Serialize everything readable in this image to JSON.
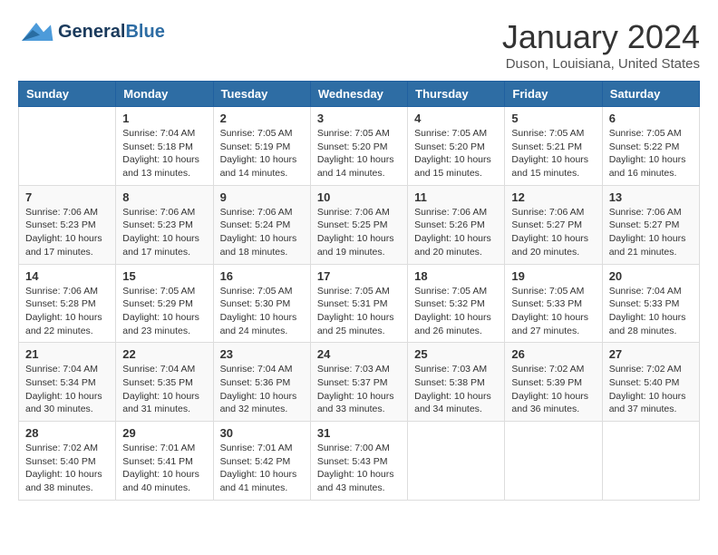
{
  "header": {
    "logo_general": "General",
    "logo_blue": "Blue",
    "month_title": "January 2024",
    "location": "Duson, Louisiana, United States"
  },
  "days_of_week": [
    "Sunday",
    "Monday",
    "Tuesday",
    "Wednesday",
    "Thursday",
    "Friday",
    "Saturday"
  ],
  "weeks": [
    [
      {
        "day": "",
        "info": ""
      },
      {
        "day": "1",
        "info": "Sunrise: 7:04 AM\nSunset: 5:18 PM\nDaylight: 10 hours\nand 13 minutes."
      },
      {
        "day": "2",
        "info": "Sunrise: 7:05 AM\nSunset: 5:19 PM\nDaylight: 10 hours\nand 14 minutes."
      },
      {
        "day": "3",
        "info": "Sunrise: 7:05 AM\nSunset: 5:20 PM\nDaylight: 10 hours\nand 14 minutes."
      },
      {
        "day": "4",
        "info": "Sunrise: 7:05 AM\nSunset: 5:20 PM\nDaylight: 10 hours\nand 15 minutes."
      },
      {
        "day": "5",
        "info": "Sunrise: 7:05 AM\nSunset: 5:21 PM\nDaylight: 10 hours\nand 15 minutes."
      },
      {
        "day": "6",
        "info": "Sunrise: 7:05 AM\nSunset: 5:22 PM\nDaylight: 10 hours\nand 16 minutes."
      }
    ],
    [
      {
        "day": "7",
        "info": "Sunrise: 7:06 AM\nSunset: 5:23 PM\nDaylight: 10 hours\nand 17 minutes."
      },
      {
        "day": "8",
        "info": "Sunrise: 7:06 AM\nSunset: 5:23 PM\nDaylight: 10 hours\nand 17 minutes."
      },
      {
        "day": "9",
        "info": "Sunrise: 7:06 AM\nSunset: 5:24 PM\nDaylight: 10 hours\nand 18 minutes."
      },
      {
        "day": "10",
        "info": "Sunrise: 7:06 AM\nSunset: 5:25 PM\nDaylight: 10 hours\nand 19 minutes."
      },
      {
        "day": "11",
        "info": "Sunrise: 7:06 AM\nSunset: 5:26 PM\nDaylight: 10 hours\nand 20 minutes."
      },
      {
        "day": "12",
        "info": "Sunrise: 7:06 AM\nSunset: 5:27 PM\nDaylight: 10 hours\nand 20 minutes."
      },
      {
        "day": "13",
        "info": "Sunrise: 7:06 AM\nSunset: 5:27 PM\nDaylight: 10 hours\nand 21 minutes."
      }
    ],
    [
      {
        "day": "14",
        "info": "Sunrise: 7:06 AM\nSunset: 5:28 PM\nDaylight: 10 hours\nand 22 minutes."
      },
      {
        "day": "15",
        "info": "Sunrise: 7:05 AM\nSunset: 5:29 PM\nDaylight: 10 hours\nand 23 minutes."
      },
      {
        "day": "16",
        "info": "Sunrise: 7:05 AM\nSunset: 5:30 PM\nDaylight: 10 hours\nand 24 minutes."
      },
      {
        "day": "17",
        "info": "Sunrise: 7:05 AM\nSunset: 5:31 PM\nDaylight: 10 hours\nand 25 minutes."
      },
      {
        "day": "18",
        "info": "Sunrise: 7:05 AM\nSunset: 5:32 PM\nDaylight: 10 hours\nand 26 minutes."
      },
      {
        "day": "19",
        "info": "Sunrise: 7:05 AM\nSunset: 5:33 PM\nDaylight: 10 hours\nand 27 minutes."
      },
      {
        "day": "20",
        "info": "Sunrise: 7:04 AM\nSunset: 5:33 PM\nDaylight: 10 hours\nand 28 minutes."
      }
    ],
    [
      {
        "day": "21",
        "info": "Sunrise: 7:04 AM\nSunset: 5:34 PM\nDaylight: 10 hours\nand 30 minutes."
      },
      {
        "day": "22",
        "info": "Sunrise: 7:04 AM\nSunset: 5:35 PM\nDaylight: 10 hours\nand 31 minutes."
      },
      {
        "day": "23",
        "info": "Sunrise: 7:04 AM\nSunset: 5:36 PM\nDaylight: 10 hours\nand 32 minutes."
      },
      {
        "day": "24",
        "info": "Sunrise: 7:03 AM\nSunset: 5:37 PM\nDaylight: 10 hours\nand 33 minutes."
      },
      {
        "day": "25",
        "info": "Sunrise: 7:03 AM\nSunset: 5:38 PM\nDaylight: 10 hours\nand 34 minutes."
      },
      {
        "day": "26",
        "info": "Sunrise: 7:02 AM\nSunset: 5:39 PM\nDaylight: 10 hours\nand 36 minutes."
      },
      {
        "day": "27",
        "info": "Sunrise: 7:02 AM\nSunset: 5:40 PM\nDaylight: 10 hours\nand 37 minutes."
      }
    ],
    [
      {
        "day": "28",
        "info": "Sunrise: 7:02 AM\nSunset: 5:40 PM\nDaylight: 10 hours\nand 38 minutes."
      },
      {
        "day": "29",
        "info": "Sunrise: 7:01 AM\nSunset: 5:41 PM\nDaylight: 10 hours\nand 40 minutes."
      },
      {
        "day": "30",
        "info": "Sunrise: 7:01 AM\nSunset: 5:42 PM\nDaylight: 10 hours\nand 41 minutes."
      },
      {
        "day": "31",
        "info": "Sunrise: 7:00 AM\nSunset: 5:43 PM\nDaylight: 10 hours\nand 43 minutes."
      },
      {
        "day": "",
        "info": ""
      },
      {
        "day": "",
        "info": ""
      },
      {
        "day": "",
        "info": ""
      }
    ]
  ]
}
